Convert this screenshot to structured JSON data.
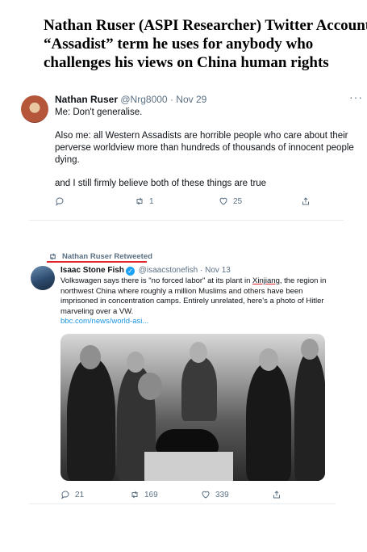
{
  "headline": {
    "line1": "Nathan Ruser (ASPI Researcher) Twitter Account",
    "line2": "“Assadist” term he uses for anybody who",
    "line3": "challenges his views on China human rights"
  },
  "tweet1": {
    "name": "Nathan Ruser",
    "handle": "@Nrg8000",
    "sep": "·",
    "date": "Nov 29",
    "more": "···",
    "paragraphs": [
      "Me: Don't generalise.",
      "Also me: all Western Assadists are horrible people who care about their perverse worldview more than hundreds of thousands of innocent people dying.",
      "and I still firmly believe both of these things are true"
    ],
    "actions": {
      "reply": "",
      "retweets": "1",
      "likes": "25"
    }
  },
  "retweet_label": "Nathan Ruser Retweeted",
  "tweet2": {
    "name": "Isaac Stone Fish",
    "handle": "@isaacstonefish",
    "sep": "·",
    "date": "Nov 13",
    "text_a": "Volkswagen says there is \"no forced labor\" at its plant in ",
    "text_highlight": "Xinjiang",
    "text_b": ", the region in northwest China where roughly a million Muslims and others have been imprisoned in concentration camps. Entirely unrelated, here's a photo of Hitler marveling over a VW.",
    "link": "bbc.com/news/world-asi...",
    "actions": {
      "replies": "21",
      "retweets": "169",
      "likes": "339"
    }
  },
  "colors": {
    "accent": "#1da1f2",
    "muted": "#5b7083",
    "red_underline": "#e0242c"
  }
}
